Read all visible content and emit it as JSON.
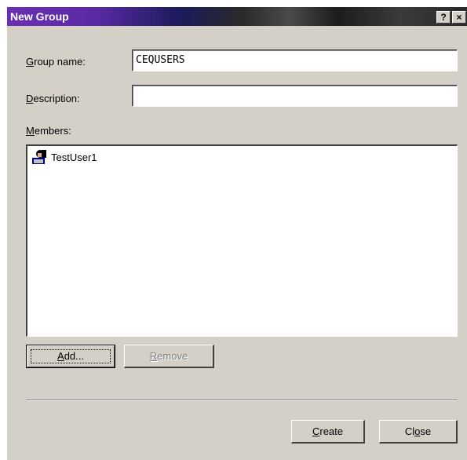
{
  "window": {
    "title": "New Group",
    "help_glyph": "?",
    "close_glyph": "×"
  },
  "form": {
    "group_name": {
      "label_access": "G",
      "label_rest": "roup name:",
      "value": "CEQUSERS"
    },
    "description": {
      "label_access": "D",
      "label_rest": "escription:",
      "value": ""
    },
    "members": {
      "label_access": "M",
      "label_rest": "embers:"
    }
  },
  "members_list": [
    {
      "name": "TestUser1",
      "icon": "user-icon"
    }
  ],
  "buttons": {
    "add": {
      "access": "A",
      "rest": "dd..."
    },
    "remove": {
      "access": "R",
      "rest": "emove",
      "enabled": false
    },
    "create": {
      "access": "C",
      "rest": "reate"
    },
    "close": {
      "pre": "Cl",
      "access": "o",
      "rest": "se"
    }
  },
  "colors": {
    "face": "#d4d0c8",
    "title_start": "#6a2fb2",
    "title_end": "#2a2a2a"
  }
}
